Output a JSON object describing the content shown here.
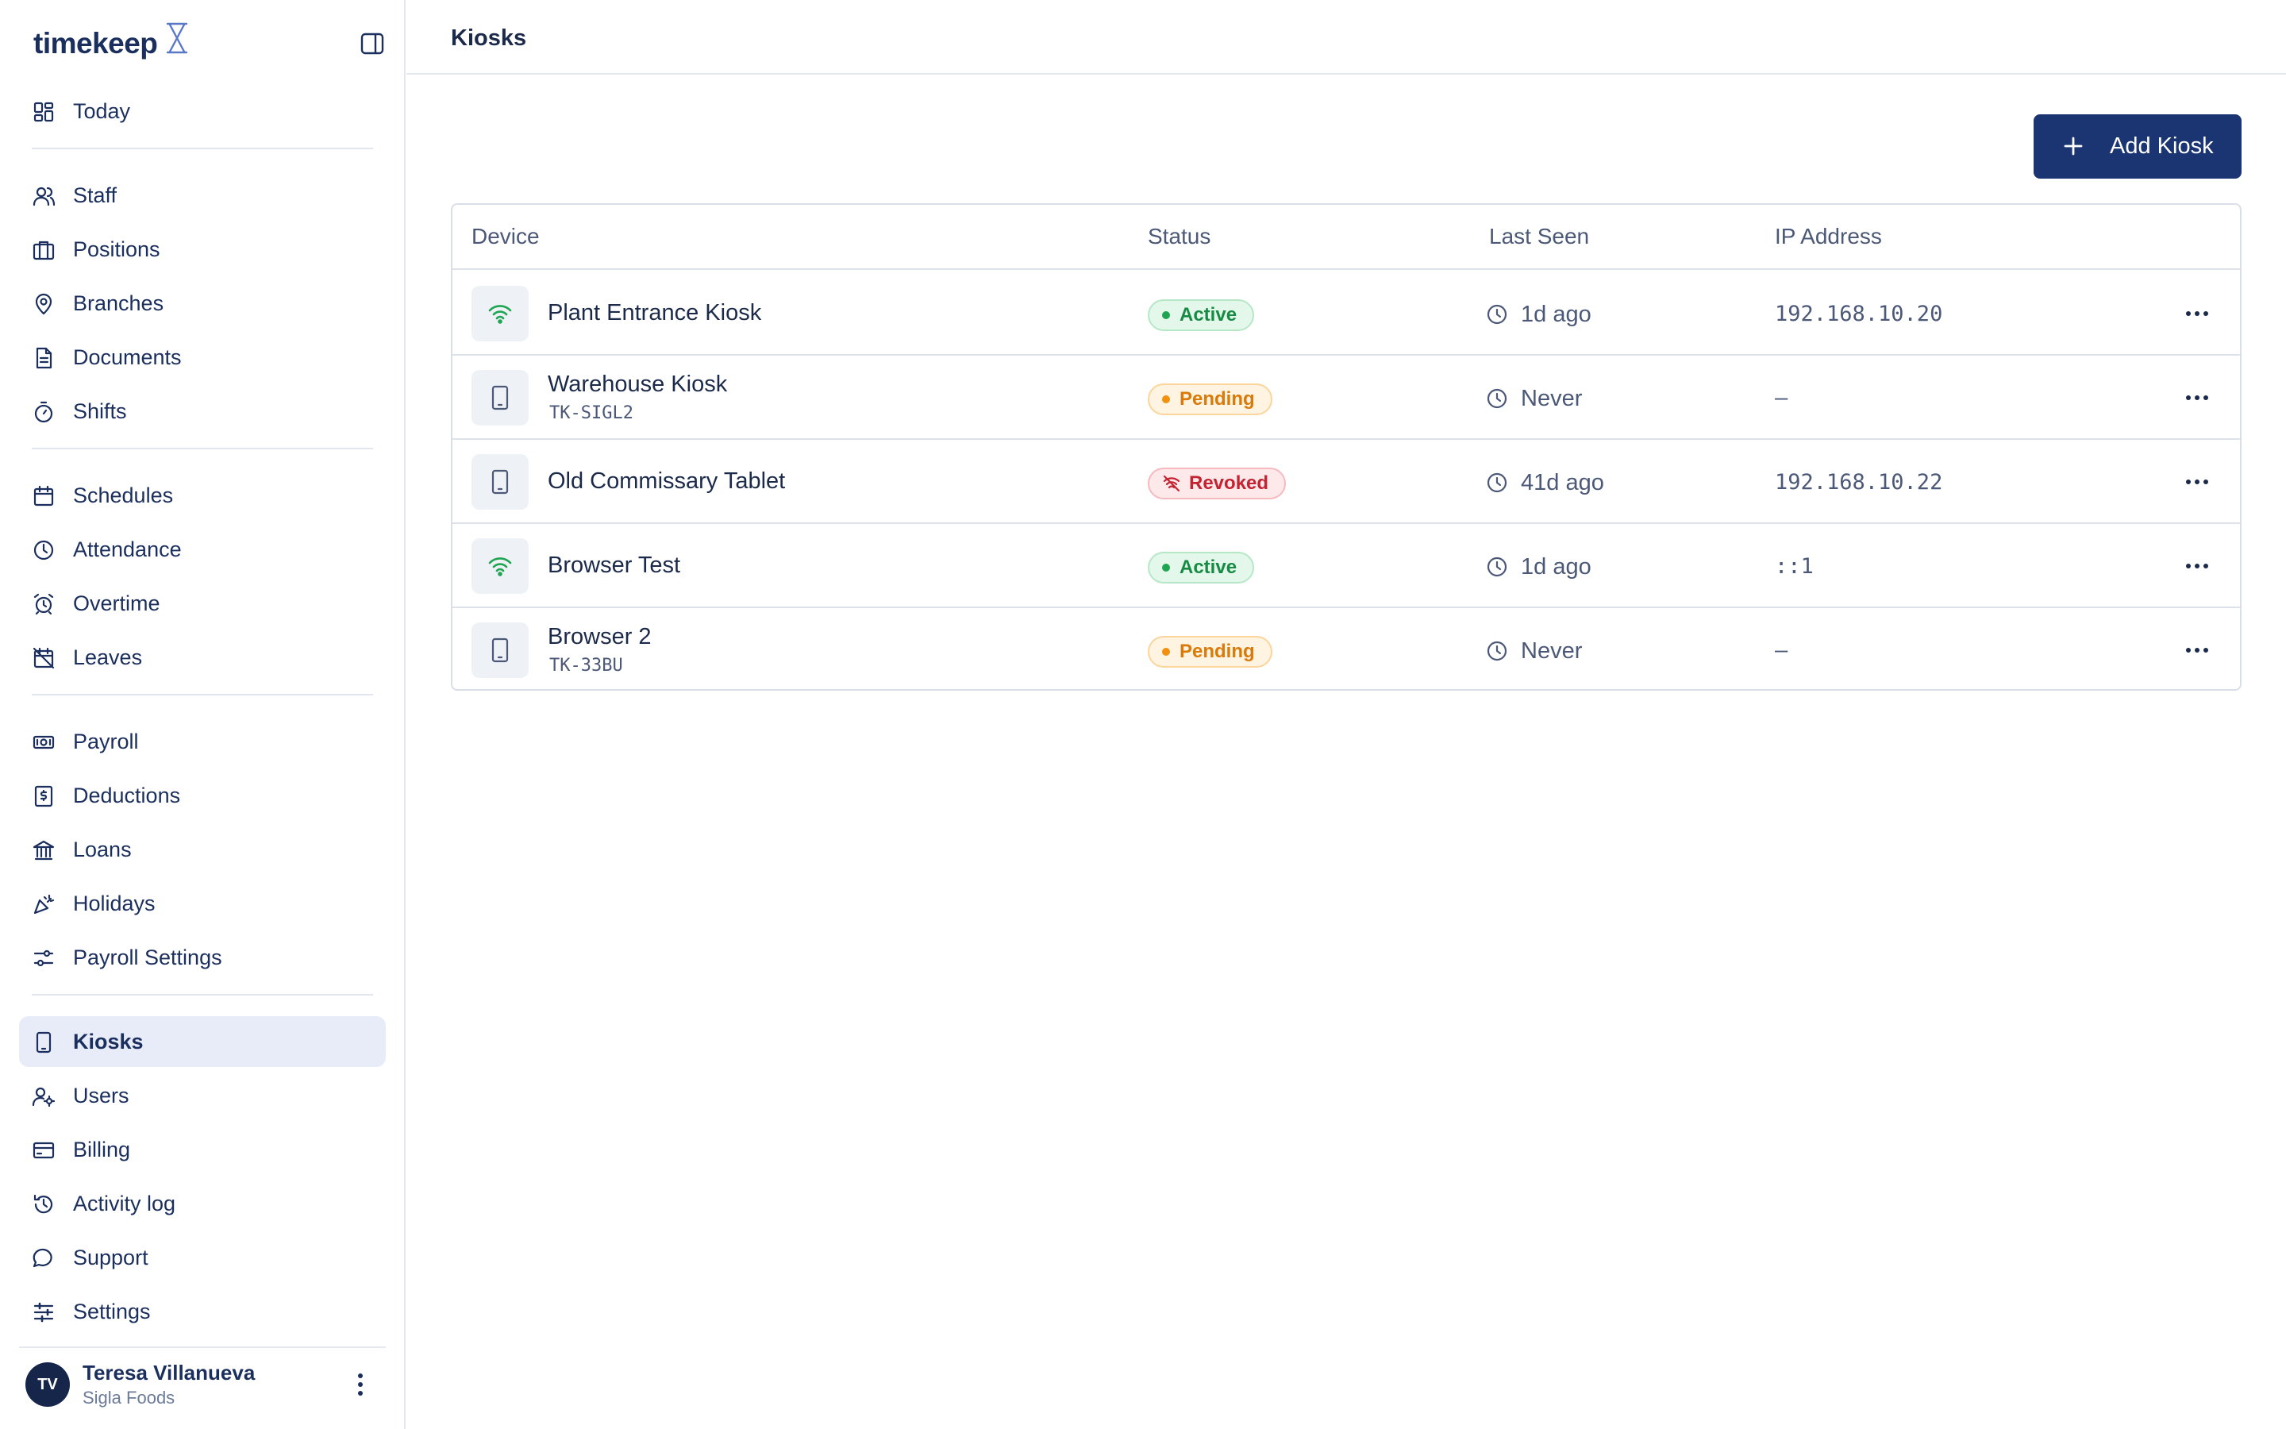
{
  "app": {
    "name": "timekeep",
    "page_title": "Kiosks"
  },
  "sidebar": {
    "groups": [
      [
        {
          "label": "Today",
          "icon": "dashboard-icon"
        }
      ],
      [
        {
          "label": "Staff",
          "icon": "users-icon"
        },
        {
          "label": "Positions",
          "icon": "briefcase-icon"
        },
        {
          "label": "Branches",
          "icon": "map-pin-icon"
        },
        {
          "label": "Documents",
          "icon": "document-icon"
        },
        {
          "label": "Shifts",
          "icon": "timer-icon"
        }
      ],
      [
        {
          "label": "Schedules",
          "icon": "calendar-icon"
        },
        {
          "label": "Attendance",
          "icon": "clock-icon"
        },
        {
          "label": "Overtime",
          "icon": "alarm-icon"
        },
        {
          "label": "Leaves",
          "icon": "calendar-off-icon"
        }
      ],
      [
        {
          "label": "Payroll",
          "icon": "banknote-icon"
        },
        {
          "label": "Deductions",
          "icon": "receipt-icon"
        },
        {
          "label": "Loans",
          "icon": "bank-icon"
        },
        {
          "label": "Holidays",
          "icon": "party-icon"
        },
        {
          "label": "Payroll Settings",
          "icon": "sliders-icon"
        }
      ],
      [
        {
          "label": "Kiosks",
          "icon": "tablet-icon",
          "active": true
        },
        {
          "label": "Users",
          "icon": "user-cog-icon"
        },
        {
          "label": "Billing",
          "icon": "credit-card-icon"
        },
        {
          "label": "Activity log",
          "icon": "history-icon"
        },
        {
          "label": "Support",
          "icon": "message-icon"
        },
        {
          "label": "Settings",
          "icon": "settings-sliders-icon"
        }
      ]
    ],
    "user": {
      "initials": "TV",
      "name": "Teresa Villanueva",
      "org": "Sigla Foods"
    }
  },
  "toolbar": {
    "add_label": "Add Kiosk"
  },
  "table": {
    "columns": [
      "Device",
      "Status",
      "Last Seen",
      "IP Address"
    ],
    "rows": [
      {
        "name": "Plant Entrance Kiosk",
        "code": "",
        "icon": "wifi-icon",
        "status": "Active",
        "status_kind": "active",
        "last_seen": "1d ago",
        "ip": "192.168.10.20"
      },
      {
        "name": "Warehouse Kiosk",
        "code": "TK-SIGL2",
        "icon": "tablet-icon",
        "status": "Pending",
        "status_kind": "pending",
        "last_seen": "Never",
        "ip": "—"
      },
      {
        "name": "Old Commissary Tablet",
        "code": "",
        "icon": "tablet-icon",
        "status": "Revoked",
        "status_kind": "revoked",
        "last_seen": "41d ago",
        "ip": "192.168.10.22"
      },
      {
        "name": "Browser Test",
        "code": "",
        "icon": "wifi-icon",
        "status": "Active",
        "status_kind": "active",
        "last_seen": "1d ago",
        "ip": "::1"
      },
      {
        "name": "Browser 2",
        "code": "TK-33BU",
        "icon": "tablet-icon",
        "status": "Pending",
        "status_kind": "pending",
        "last_seen": "Never",
        "ip": "—"
      }
    ]
  },
  "colors": {
    "brand": "#1b3472",
    "active": "#1fa551",
    "pending": "#f29010",
    "revoked": "#c42331"
  }
}
